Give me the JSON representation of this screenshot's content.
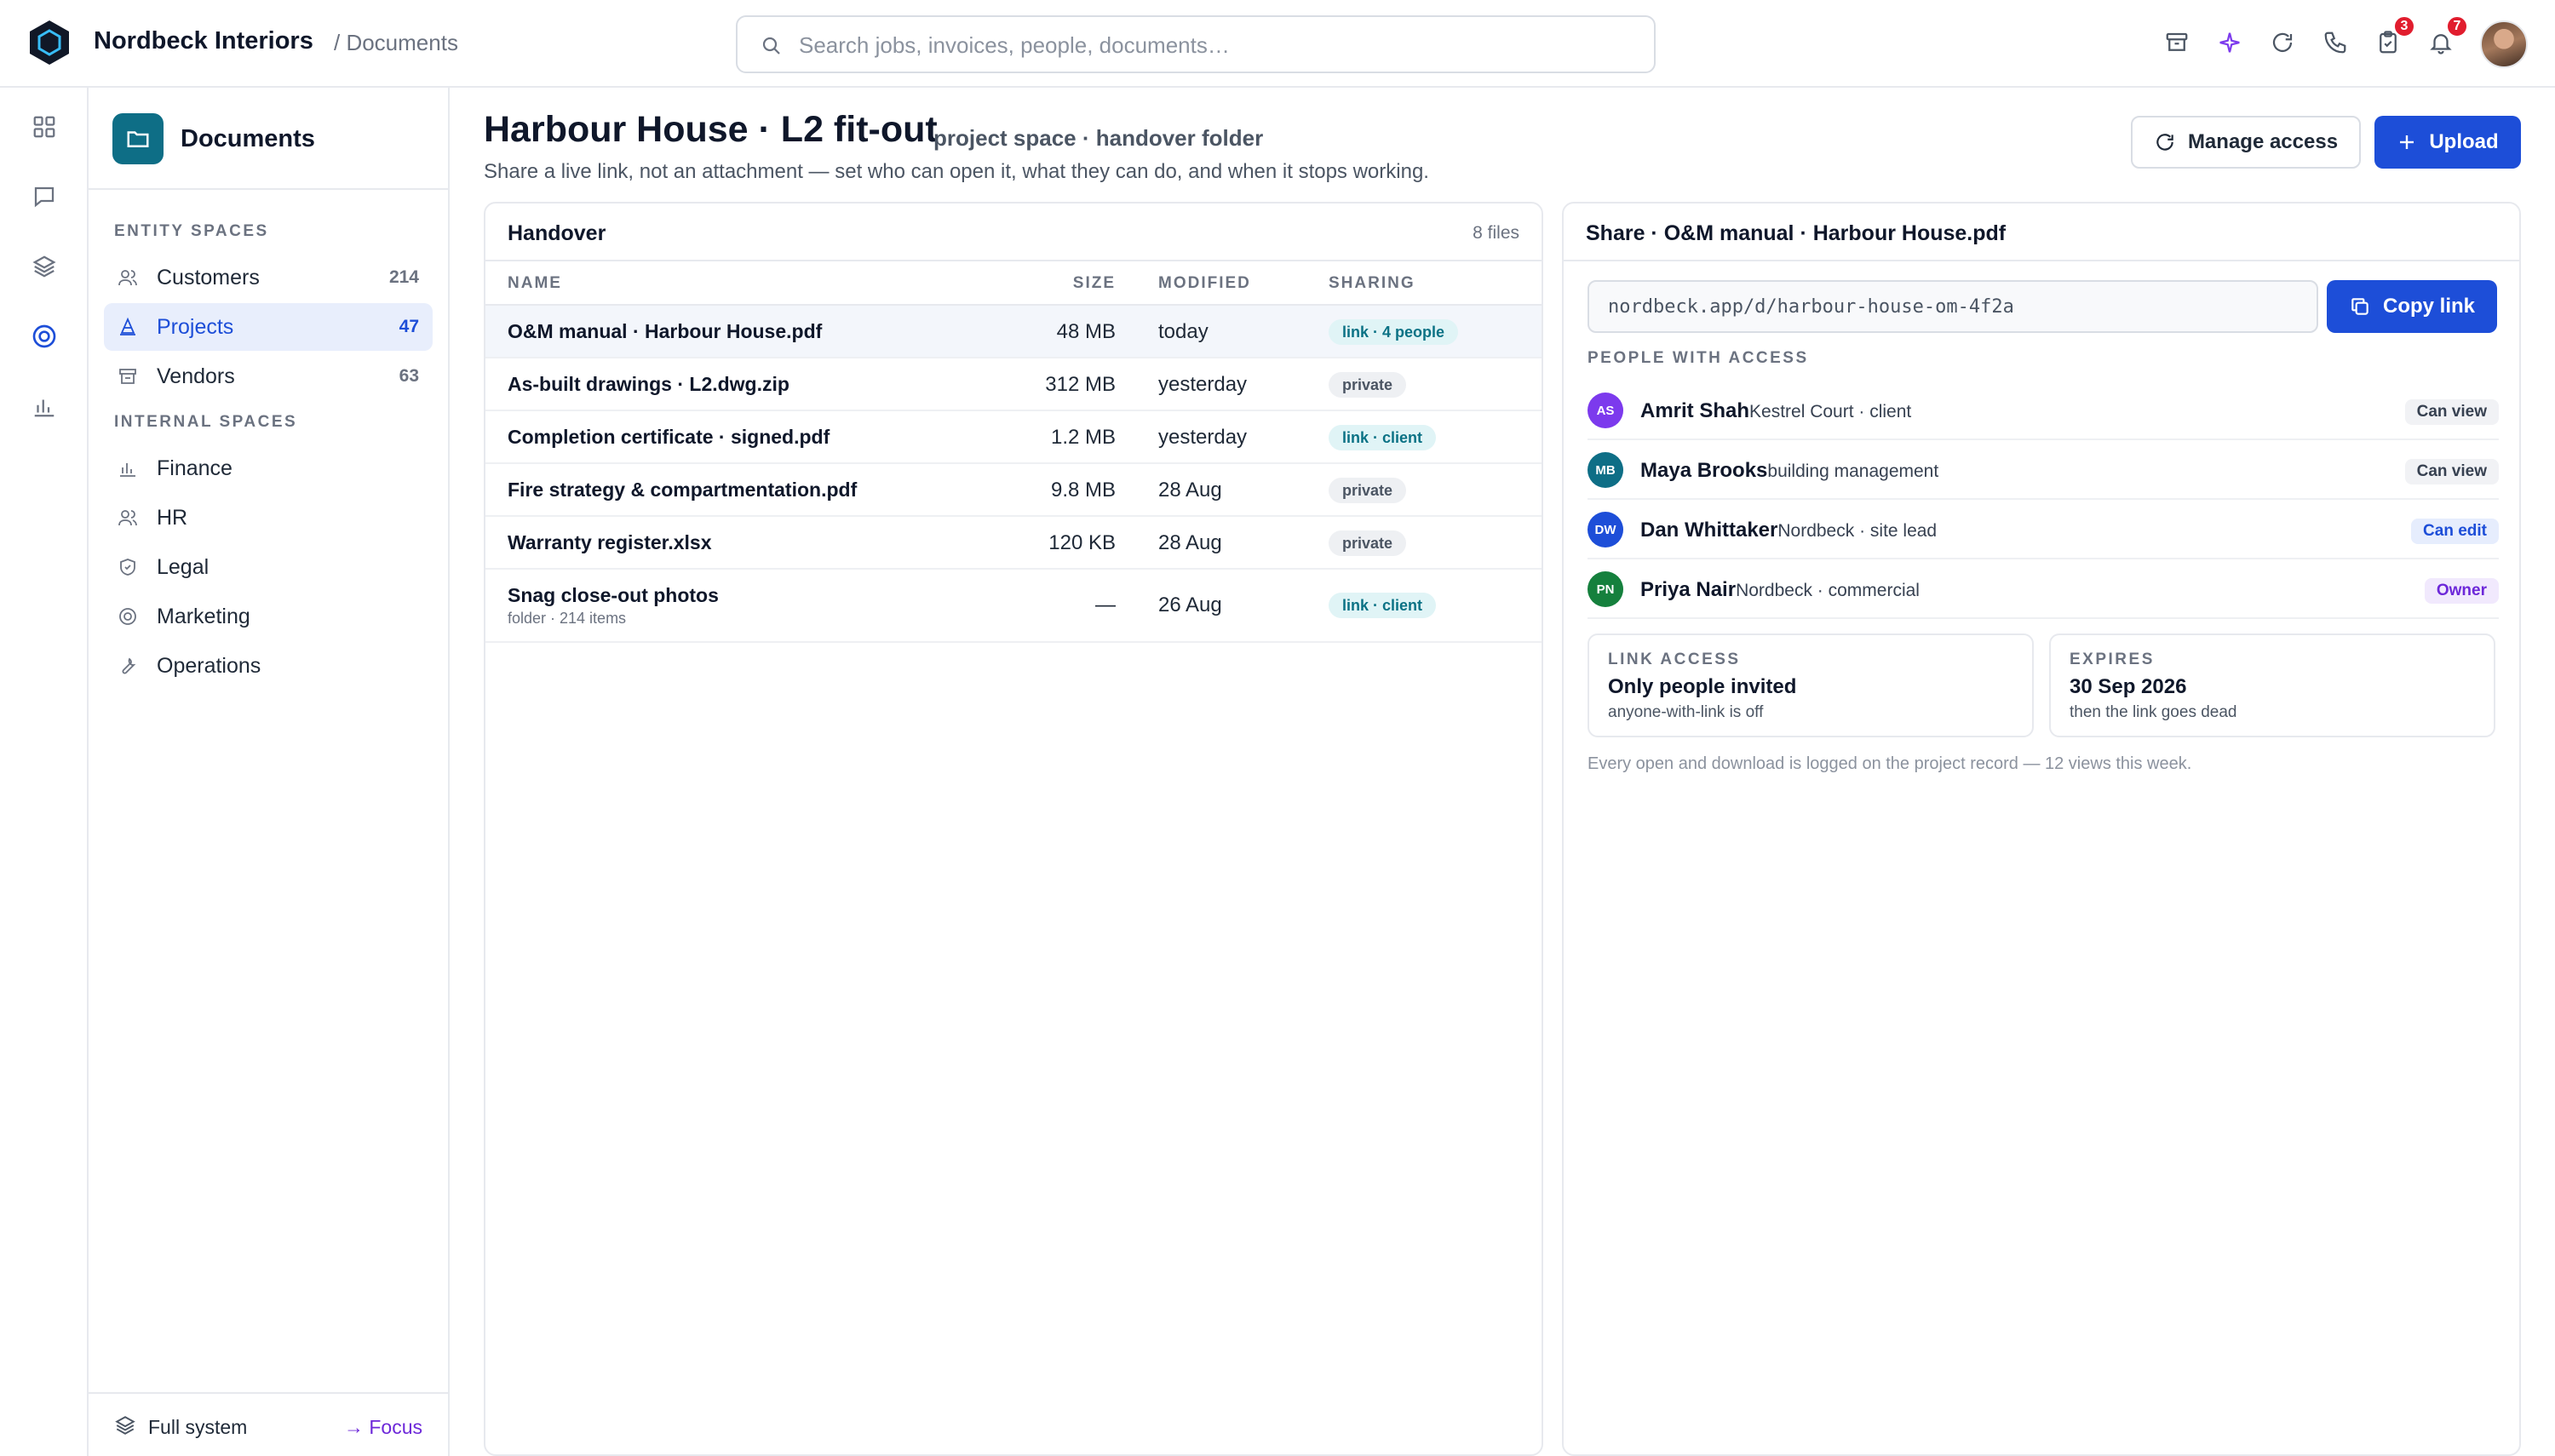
{
  "app": {
    "brand": "Nordbeck Interiors",
    "breadcrumb": "/ Documents"
  },
  "search": {
    "placeholder": "Search jobs, invoices, people, documents…"
  },
  "topbar": {
    "icons": [
      "archive-icon",
      "sparkle-icon",
      "refresh-icon",
      "phone-icon",
      "clipboard-icon",
      "bell-icon"
    ],
    "tasks_badge": "3",
    "notifications_badge": "7",
    "accent_color": "#7c3aed"
  },
  "rail": [
    "grid-icon",
    "chat-icon",
    "layers-icon",
    "target-icon",
    "bar-chart-icon"
  ],
  "sidebar": {
    "title": "Documents",
    "entity_label": "ENTITY SPACES",
    "entity_items": [
      {
        "label": "Customers",
        "count": "214",
        "icon": "people-icon"
      },
      {
        "label": "Projects",
        "count": "47",
        "icon": "cone-icon",
        "active": true
      },
      {
        "label": "Vendors",
        "count": "63",
        "icon": "store-icon"
      }
    ],
    "internal_label": "INTERNAL SPACES",
    "internal_items": [
      {
        "label": "Finance",
        "icon": "bar-chart-icon"
      },
      {
        "label": "HR",
        "icon": "people-icon"
      },
      {
        "label": "Legal",
        "icon": "shield-icon"
      },
      {
        "label": "Marketing",
        "icon": "target-icon"
      },
      {
        "label": "Operations",
        "icon": "wrench-icon"
      }
    ],
    "footer": {
      "full_system": "Full system",
      "focus": "→ Focus"
    }
  },
  "page": {
    "title": "Harbour House · L2 fit-out",
    "subtitle": "project space · handover folder",
    "description": "Share a live link, not an attachment — set who can open it, what they can do, and when it stops working.",
    "manage_access": "Manage access",
    "upload": "Upload",
    "primary_color": "#1d4ed8"
  },
  "files": {
    "title": "Handover",
    "count": "8 files",
    "columns": {
      "name": "NAME",
      "size": "SIZE",
      "modified": "MODIFIED",
      "sharing": "SHARING"
    },
    "rows": [
      {
        "name": "O&M manual · Harbour House.pdf",
        "size": "48 MB",
        "modified": "today",
        "sharing": "link · 4 people",
        "kind": "link",
        "selected": true
      },
      {
        "name": "As-built drawings · L2.dwg.zip",
        "size": "312 MB",
        "modified": "yesterday",
        "sharing": "private",
        "kind": "private"
      },
      {
        "name": "Completion certificate · signed.pdf",
        "size": "1.2 MB",
        "modified": "yesterday",
        "sharing": "link · client",
        "kind": "link"
      },
      {
        "name": "Fire strategy & compartmentation.pdf",
        "size": "9.8 MB",
        "modified": "28 Aug",
        "sharing": "private",
        "kind": "private"
      },
      {
        "name": "Warranty register.xlsx",
        "size": "120 KB",
        "modified": "28 Aug",
        "sharing": "private",
        "kind": "private"
      },
      {
        "name": "Snag close-out photos",
        "sub": "folder · 214 items",
        "size": "—",
        "modified": "26 Aug",
        "sharing": "link · client",
        "kind": "link"
      }
    ]
  },
  "share": {
    "title": "Share · O&M manual · Harbour House.pdf",
    "url": "nordbeck.app/d/harbour-house-om-4f2a",
    "copy_label": "Copy link",
    "people_label": "PEOPLE WITH ACCESS",
    "people": [
      {
        "initials": "AS",
        "name": "Amrit Shah",
        "detail": "Kestrel Court · client",
        "role": "Can view",
        "role_kind": "view",
        "color": "#7c3aed"
      },
      {
        "initials": "MB",
        "name": "Maya Brooks",
        "detail": "building management",
        "role": "Can view",
        "role_kind": "view",
        "color": "#0e6e86"
      },
      {
        "initials": "DW",
        "name": "Dan Whittaker",
        "detail": "Nordbeck · site lead",
        "role": "Can edit",
        "role_kind": "edit",
        "color": "#1d4ed8"
      },
      {
        "initials": "PN",
        "name": "Priya Nair",
        "detail": "Nordbeck · commercial",
        "role": "Owner",
        "role_kind": "owner",
        "color": "#15803d"
      }
    ],
    "link_access": {
      "label": "LINK ACCESS",
      "value": "Only people invited",
      "sub": "anyone-with-link is off"
    },
    "expires": {
      "label": "EXPIRES",
      "value": "30 Sep 2026",
      "sub": "then the link goes dead"
    },
    "note": "Every open and download is logged on the project record — 12 views this week."
  }
}
